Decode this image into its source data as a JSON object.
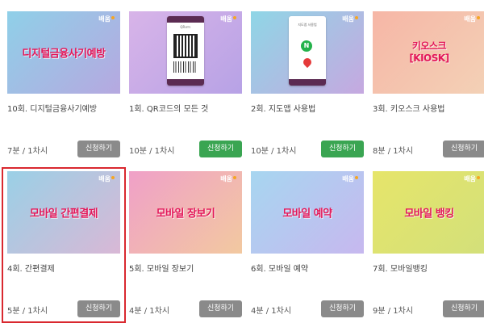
{
  "brand": {
    "mark_text": "배움",
    "accent": "#e3185a"
  },
  "selected_color": "#d9282f",
  "cards": [
    {
      "thumb_title": "디지털금융사기예방",
      "title": "10회. 디지털금융사기예방",
      "duration": "7분 / 1차시",
      "button": "신청하기",
      "button_style": "gray",
      "thumb_colors": [
        "#8fd0e8",
        "#b6a8e0"
      ]
    },
    {
      "thumb_title": "",
      "phone_header": "QR코드",
      "title": "1회. QR코드의 모든 것",
      "duration": "10분 / 1차시",
      "button": "신청하기",
      "button_style": "green",
      "thumb_colors": [
        "#d8b4e8",
        "#b7a2e6"
      ]
    },
    {
      "thumb_title": "",
      "phone_header": "지도앱 사용법",
      "title": "2회. 지도앱 사용법",
      "duration": "10분 / 1차시",
      "button": "신청하기",
      "button_style": "green",
      "thumb_colors": [
        "#8fd6e6",
        "#c6a8e0"
      ]
    },
    {
      "thumb_title": "키오스크\n[KIOSK]",
      "title": "3회. 키오스크 사용법",
      "duration": "8분 / 1차시",
      "button": "신청하기",
      "button_style": "gray",
      "thumb_colors": [
        "#f6b6a6",
        "#f3d1b6"
      ]
    },
    {
      "thumb_title": "모바일 간편결제",
      "title": "4회. 간편결제",
      "duration": "5분 / 1차시",
      "button": "신청하기",
      "button_style": "gray",
      "selected": true,
      "thumb_colors": [
        "#9ad0e6",
        "#d9b8d6"
      ]
    },
    {
      "thumb_title": "모바일 장보기",
      "title": "5회. 모바일 장보기",
      "duration": "4분 / 1차시",
      "button": "신청하기",
      "button_style": "gray",
      "thumb_colors": [
        "#f0a0c8",
        "#f2c9a0"
      ]
    },
    {
      "thumb_title": "모바일 예약",
      "title": "6회. 모바일 예약",
      "duration": "4분 / 1차시",
      "button": "신청하기",
      "button_style": "gray",
      "thumb_colors": [
        "#a7d6f0",
        "#c7b8ef"
      ]
    },
    {
      "thumb_title": "모바일 뱅킹",
      "title": "7회. 모바일뱅킹",
      "duration": "9분 / 1차시",
      "button": "신청하기",
      "button_style": "gray",
      "thumb_colors": [
        "#e6e56a",
        "#d3e07a"
      ]
    }
  ]
}
